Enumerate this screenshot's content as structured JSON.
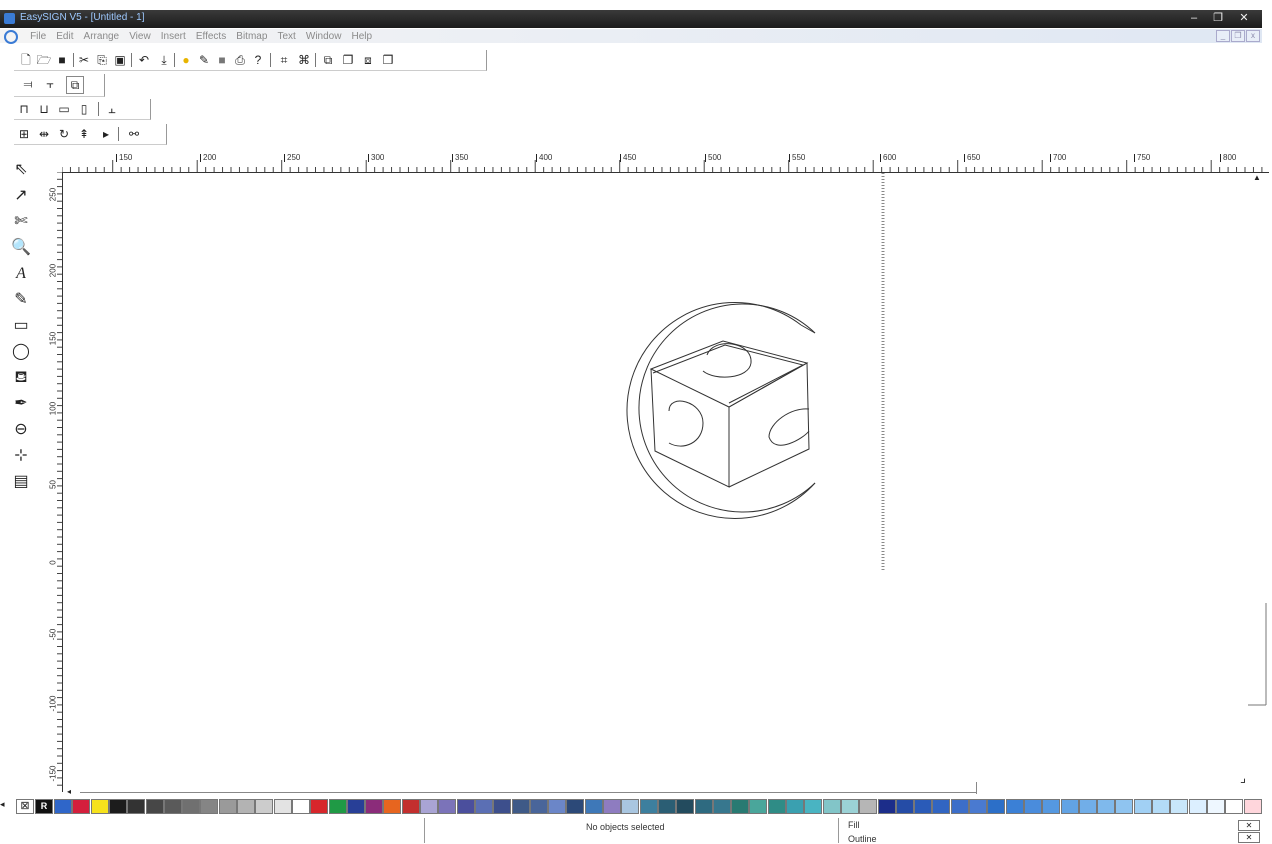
{
  "window": {
    "title": "EasySIGN V5 - [Untitled - 1]",
    "controls": [
      "–",
      "❐",
      "✕"
    ]
  },
  "menu": {
    "items": [
      "File",
      "Edit",
      "Arrange",
      "View",
      "Insert",
      "Effects",
      "Bitmap",
      "Text",
      "Window",
      "Help"
    ],
    "mdi_controls": [
      "_",
      "❐",
      "x"
    ]
  },
  "toolbars": {
    "standard": [
      "new-icon",
      "open-icon",
      "save-icon",
      "cut-icon",
      "copy-icon",
      "paste-icon",
      "undo-icon",
      "import-icon",
      "color-icon",
      "pen-icon",
      "fill-icon",
      "print-icon",
      "help-icon",
      "group-icon",
      "ungroup-icon",
      "front-icon",
      "back-icon",
      "forward-icon",
      "backward-icon"
    ],
    "align": [
      "align-left-icon",
      "align-center-icon",
      "align-copy-icon"
    ],
    "lock": [
      "lock-icon",
      "unlock-icon",
      "weld-icon",
      "combine-icon",
      "break-icon"
    ],
    "order": [
      "distribute-icon",
      "mirror-icon",
      "rotate-icon",
      "to-top-icon",
      "arrow-icon",
      "binoculars-icon"
    ]
  },
  "tools": [
    "select-tool",
    "shape-tool",
    "knife-tool",
    "zoom-tool",
    "text-tool",
    "pen-tool",
    "rectangle-tool",
    "ellipse-tool",
    "fill-tool",
    "outline-tool",
    "contour-tool",
    "blend-tool",
    "bitmap-tool"
  ],
  "ruler": {
    "horizontal": [
      "150",
      "200",
      "250",
      "300",
      "350",
      "400",
      "450",
      "500",
      "550",
      "600",
      "650",
      "700",
      "750",
      "800"
    ],
    "vertical": [
      "250",
      "200",
      "150",
      "100",
      "50",
      "0",
      "-50",
      "-100",
      "-150"
    ]
  },
  "palette": {
    "no_color": "⊠",
    "registration": "R",
    "colors": [
      "#2f66c9",
      "#d41f3c",
      "#f6e21c",
      "#1c1c1c",
      "#333333",
      "#474747",
      "#5a5a5a",
      "#707070",
      "#858585",
      "#9a9a9a",
      "#b3b3b3",
      "#cccccc",
      "#e3e3e3",
      "#ffffff",
      "#d7262b",
      "#1f9a45",
      "#283f97",
      "#8b2c7a",
      "#e7651f",
      "#c32f2e",
      "#a9a4d4",
      "#7b73b9",
      "#4b4f9d",
      "#5b6fb4",
      "#3d4f8c",
      "#3f5a87",
      "#49659a",
      "#6b86c8",
      "#2c4978",
      "#3e78b8",
      "#8e7cc0",
      "#a9c6e0",
      "#3d7f9e",
      "#2b5e74",
      "#234b5e",
      "#2e6a80",
      "#37778e",
      "#297a72",
      "#4aa69b",
      "#2f8c86",
      "#3aa0b0",
      "#49b4c2",
      "#82c5c8",
      "#9bd2d6",
      "#b6b6b6",
      "#1c2d8a",
      "#254ca6",
      "#2a5bb8",
      "#3165c2",
      "#3c6ec9",
      "#4a7ad0",
      "#2c6fc8",
      "#3b80d6",
      "#4a8cdc",
      "#5598e0",
      "#62a3e4",
      "#71aee8",
      "#7fb9ec",
      "#8fc4f0",
      "#a1d0f4",
      "#b3dbf7",
      "#c8e6fa",
      "#dcefff",
      "#eef7ff",
      "#ffffff",
      "#ffd6dc"
    ]
  },
  "status": {
    "message": "No objects selected",
    "fill_label": "Fill",
    "outline_label": "Outline"
  }
}
